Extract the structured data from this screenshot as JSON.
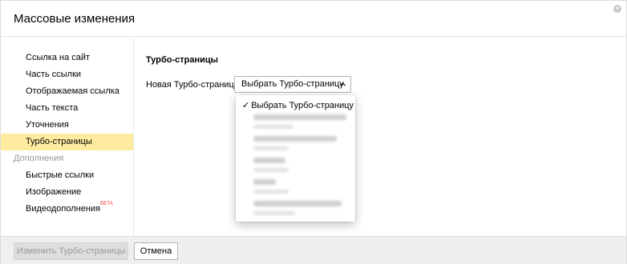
{
  "dialog": {
    "title": "Массовые изменения",
    "close_icon": "close-icon"
  },
  "sidebar": {
    "items": [
      {
        "label": "Ссылка на сайт"
      },
      {
        "label": "Часть ссылки"
      },
      {
        "label": "Отображаемая ссылка"
      },
      {
        "label": "Часть текста"
      },
      {
        "label": "Уточнения"
      },
      {
        "label": "Турбо-страницы",
        "active": true
      }
    ],
    "group_label": "Дополнения",
    "extra_items": [
      {
        "label": "Быстрые ссылки"
      },
      {
        "label": "Изображение"
      },
      {
        "label": "Видеодополнения",
        "badge": "BETA"
      }
    ]
  },
  "main": {
    "section_title": "Турбо-страницы",
    "field_label": "Новая Турбо-страница:",
    "select_value": "Выбрать Турбо-страницу",
    "chevron_icon": "chevron-up-icon"
  },
  "dropdown": {
    "selected_option": "Выбрать Турбо-страницу",
    "check_glyph": "✓",
    "blurred_option_count": 5
  },
  "footer": {
    "apply_label": "Изменить Турбо-страницы",
    "cancel_label": "Отмена"
  },
  "colors": {
    "active_bg": "#ffeba0",
    "beta_badge": "#ff3333",
    "footer_bg": "#efefef",
    "muted_text": "#999999"
  }
}
